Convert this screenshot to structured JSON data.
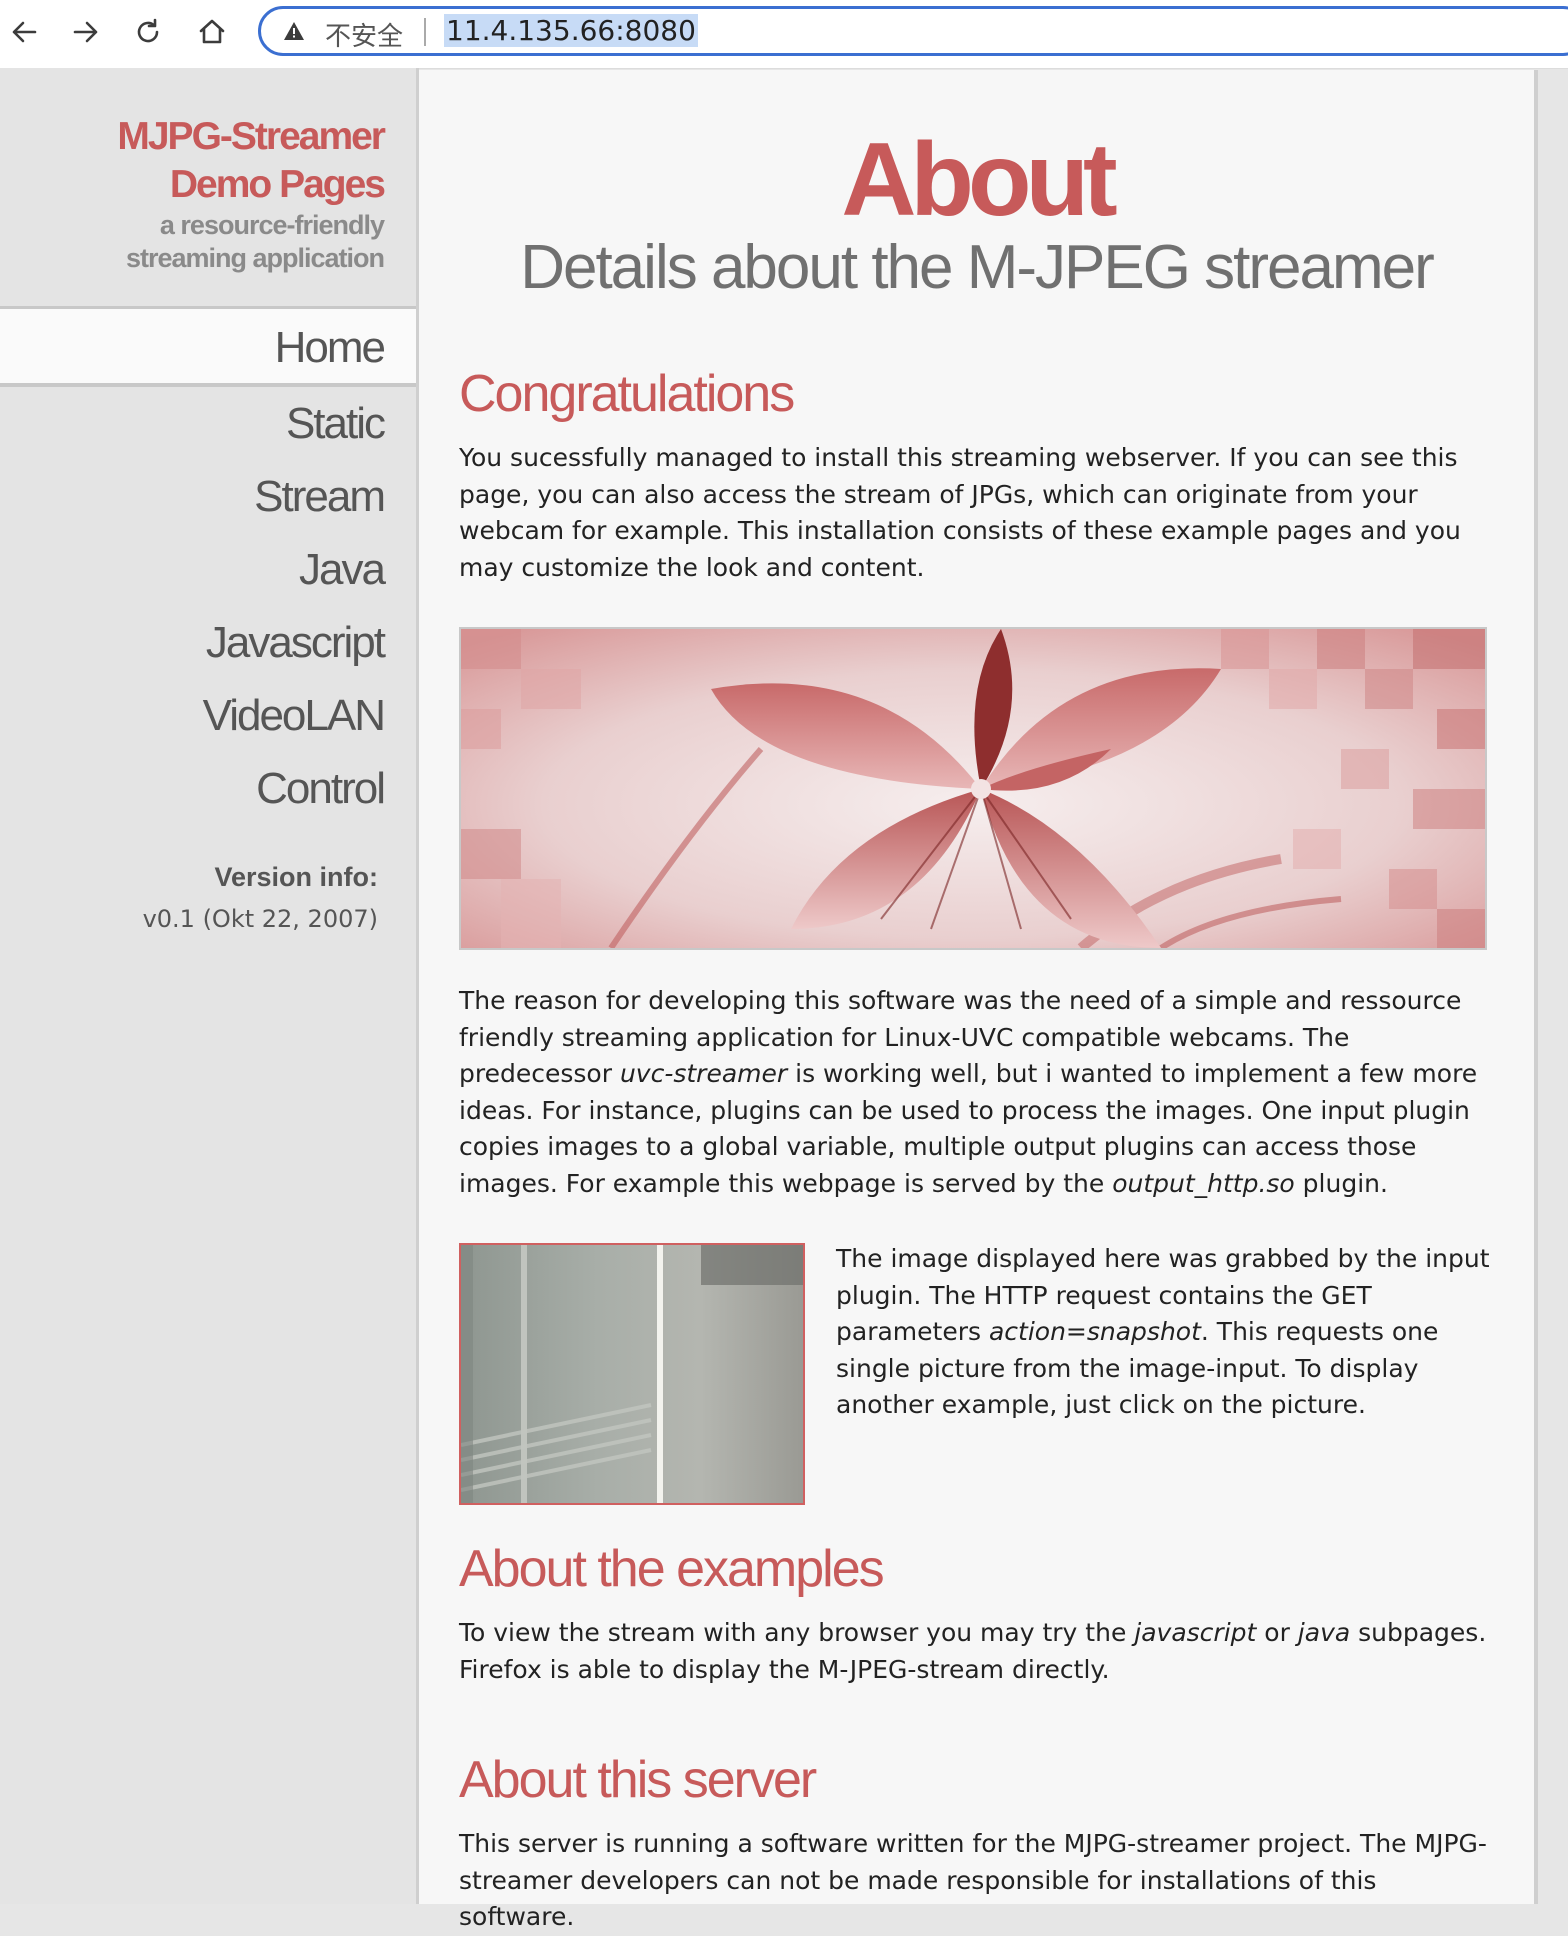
{
  "browser": {
    "security_label": "不安全",
    "url": "11.4.135.66:8080"
  },
  "sidebar": {
    "brand": {
      "line1": "MJPG-Streamer",
      "line2": "Demo Pages",
      "tagline1": "a resource-friendly",
      "tagline2": "streaming application"
    },
    "nav": [
      {
        "label": "Home",
        "active": true
      },
      {
        "label": "Static"
      },
      {
        "label": "Stream"
      },
      {
        "label": "Java"
      },
      {
        "label": "Javascript"
      },
      {
        "label": "VideoLAN"
      },
      {
        "label": "Control"
      }
    ],
    "version_label": "Version info:",
    "version_value": "v0.1 (Okt 22, 2007)"
  },
  "main": {
    "title": "About",
    "subtitle": "Details about the M-JPEG streamer",
    "sections": {
      "congrats": {
        "heading": "Congratulations",
        "text": "You sucessfully managed to install this streaming webserver. If you can see this page, you can also access the stream of JPGs, which can originate from your webcam for example. This installation consists of these example pages and you may customize the look and content."
      },
      "reason": {
        "p1": "The reason for developing this software was the need of a simple and ressource friendly streaming application for Linux-UVC compatible webcams. The predecessor ",
        "em1": "uvc-streamer",
        "p2": " is working well, but i wanted to implement a few more ideas. For instance, plugins can be used to process the images. One input plugin copies images to a global variable, multiple output plugins can access those images. For example this webpage is served by the ",
        "em2": "output_http.so",
        "p3": " plugin."
      },
      "snapshot": {
        "p1": "The image displayed here was grabbed by the input plugin. The HTTP request contains the GET parameters ",
        "em1": "action=snapshot",
        "p2": ". This requests one single picture from the image-input. To display another example, just click on the picture."
      },
      "examples": {
        "heading": "About the examples",
        "p1": "To view the stream with any browser you may try the ",
        "em1": "javascript",
        "p2": " or ",
        "em2": "java",
        "p3": " subpages. Firefox is able to display the M-JPEG-stream directly."
      },
      "server": {
        "heading": "About this server",
        "text": "This server is running a software written for the MJPG-streamer project. The MJPG-streamer developers can not be made responsible for installations of this software."
      }
    }
  },
  "colors": {
    "accent": "#c75a5a",
    "sidebar_bg": "#e4e4e4",
    "content_bg": "#f7f7f7",
    "url_highlight": "#c7dbf6",
    "address_border": "#3b6fd1"
  },
  "icons": [
    "back-arrow-icon",
    "forward-arrow-icon",
    "reload-icon",
    "home-icon",
    "warning-icon"
  ]
}
